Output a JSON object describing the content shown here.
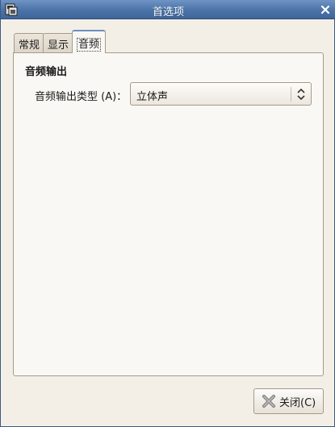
{
  "window": {
    "title": "首选项"
  },
  "tabs": [
    {
      "label": "常规",
      "active": false
    },
    {
      "label": "显示",
      "active": false
    },
    {
      "label": "音频",
      "active": true
    }
  ],
  "audio": {
    "section_title": "音频输出",
    "output_type_label": "音频输出类型 (A)：",
    "output_type_value": "立体声"
  },
  "buttons": {
    "close_label": "关闭(C)"
  },
  "icons": {
    "app": "app-window-icon",
    "titlebar_close": "close-x-icon",
    "combo_arrows": "up-down-arrows-icon",
    "close_button": "close-x-icon"
  },
  "colors": {
    "titlebar": "#4b73a8",
    "background": "#f4efe6",
    "panel": "#faf8f4",
    "active_tab_accent": "#6d8fc0"
  }
}
